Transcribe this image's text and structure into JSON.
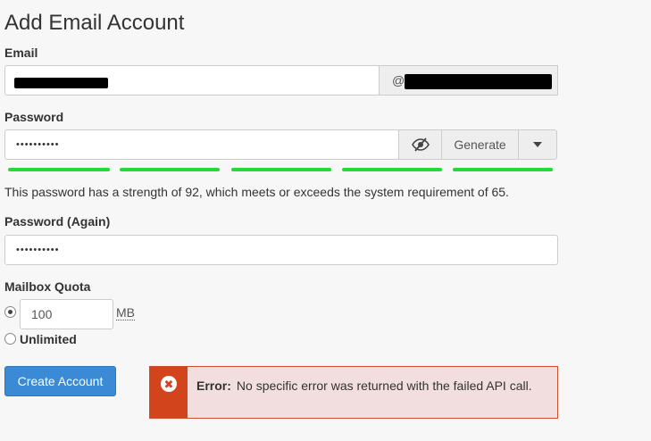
{
  "page": {
    "title": "Add Email Account"
  },
  "email": {
    "label": "Email",
    "username_value": "",
    "domain_prefix": "@",
    "domain_value": ""
  },
  "password": {
    "label": "Password",
    "masked_value": "••••••••••",
    "toggle_icon": "eye-slash-icon",
    "generate_label": "Generate",
    "dropdown_icon": "caret-down-icon",
    "strength_segments_filled": 5,
    "strength_segments_total": 5,
    "strength_color": "#26d93a",
    "help_text": "This password has a strength of 92, which meets or exceeds the system requirement of 65."
  },
  "password_again": {
    "label": "Password (Again)",
    "masked_value": "••••••••••"
  },
  "quota": {
    "label": "Mailbox Quota",
    "value": "100",
    "unit": "MB",
    "unlimited_label": "Unlimited",
    "selected": "limited"
  },
  "actions": {
    "create_label": "Create Account"
  },
  "alert": {
    "icon": "error-x-icon",
    "title": "Error:",
    "message": "No specific error was returned with the failed API call.",
    "accent_color": "#d2441c",
    "background_color": "#f2dede"
  }
}
